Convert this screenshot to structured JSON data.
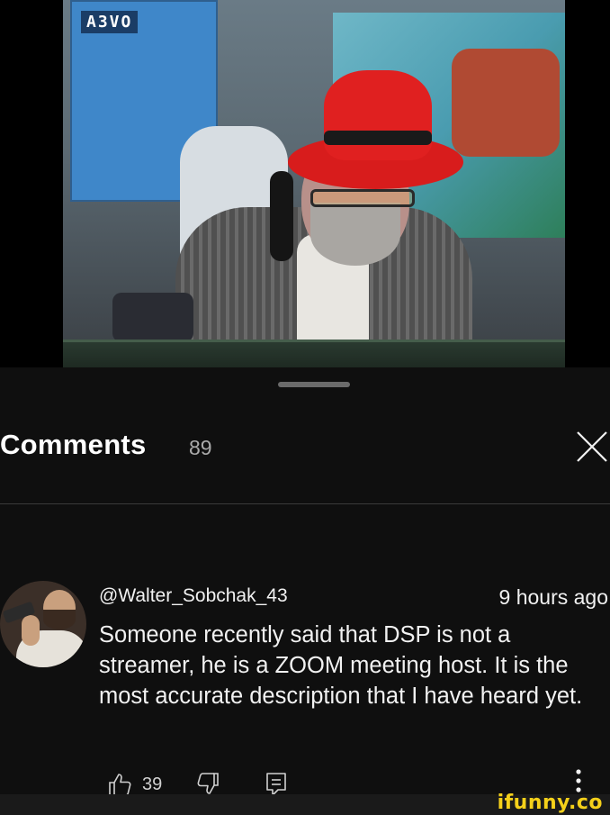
{
  "sheet": {
    "title": "Comments",
    "count": "89"
  },
  "comment": {
    "author": "@Walter_Sobchak_43",
    "timestamp": "9 hours ago",
    "text": "Someone recently said that DSP is not a streamer, he is a ZOOM meeting host. It is the most accurate description that I have heard yet.",
    "likes": "39"
  },
  "video": {
    "poster_logo": "A3VO"
  },
  "watermark": "ifunny.co",
  "icons": {
    "close": "close-icon",
    "like": "thumbs-up-icon",
    "dislike": "thumbs-down-icon",
    "reply": "reply-icon",
    "more": "more-vertical-icon"
  },
  "colors": {
    "background": "#0f0f0f",
    "text": "#f1f1f1",
    "muted": "#aaaaaa",
    "watermark": "#f4d01a",
    "hat": "#e02020"
  }
}
